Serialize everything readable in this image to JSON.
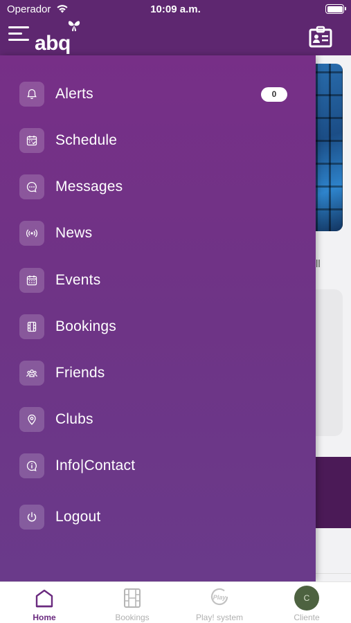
{
  "status_bar": {
    "carrier": "Operador",
    "time": "10:09 a.m."
  },
  "header": {
    "logo_text": "abq"
  },
  "background": {
    "partial_text": "ll"
  },
  "drawer": {
    "items": [
      {
        "label": "Alerts",
        "icon": "bell-icon",
        "badge": "0"
      },
      {
        "label": "Schedule",
        "icon": "calendar-check-icon"
      },
      {
        "label": "Messages",
        "icon": "chat-bubble-icon"
      },
      {
        "label": "News",
        "icon": "broadcast-icon"
      },
      {
        "label": "Events",
        "icon": "calendar-grid-icon"
      },
      {
        "label": "Bookings",
        "icon": "ticket-icon"
      },
      {
        "label": "Friends",
        "icon": "group-icon"
      },
      {
        "label": "Clubs",
        "icon": "map-pin-icon"
      },
      {
        "label": "Info|Contact",
        "icon": "info-icon"
      },
      {
        "label": "Logout",
        "icon": "power-icon"
      }
    ]
  },
  "tabbar": {
    "tabs": [
      {
        "label": "Home",
        "icon": "home-icon",
        "active": true
      },
      {
        "label": "Bookings",
        "icon": "ticket-icon",
        "active": false
      },
      {
        "label": "Play! system",
        "icon": "play-system-icon",
        "active": false
      },
      {
        "label": "Cliente",
        "icon": "avatar",
        "active": false,
        "avatar_initial": "C"
      }
    ]
  },
  "colors": {
    "header": "#5e2770",
    "drawer": "#772f87",
    "accent": "#6a2a7f",
    "avatar": "#4d6240"
  }
}
